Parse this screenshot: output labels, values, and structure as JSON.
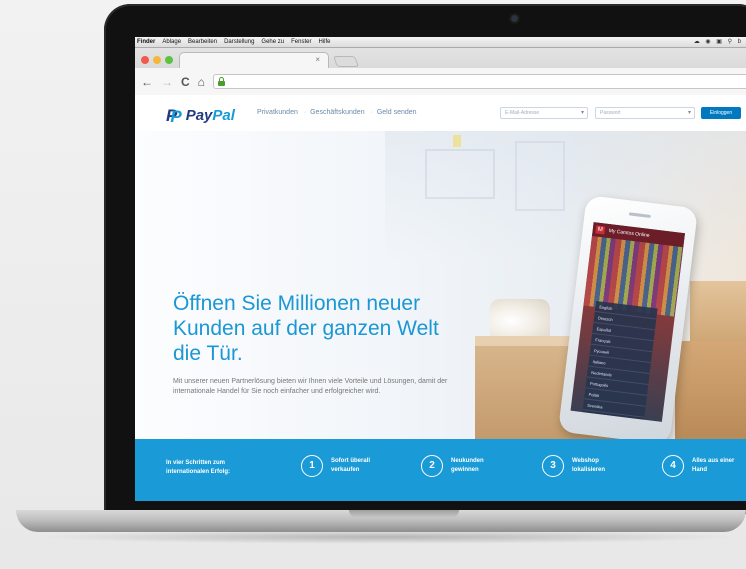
{
  "os_menubar": {
    "items": [
      "Finder",
      "Ablage",
      "Bearbeiten",
      "Darstellung",
      "Gehe zu",
      "Fenster",
      "Hilfe"
    ],
    "status": "☁ ◉ ▣ ⚲ b"
  },
  "browser": {
    "tab_close": "×",
    "nav": {
      "back": "←",
      "forward": "→",
      "reload": "C",
      "home": "⌂"
    }
  },
  "site": {
    "brand": {
      "logo_p": "P",
      "pay": "Pay",
      "pal": "Pal"
    },
    "nav": [
      "Privatkunden",
      "Geschäftskunden",
      "Geld senden"
    ],
    "nav_separator": "·",
    "email_placeholder": "E-Mail-Adresse",
    "password_placeholder": "Passwort",
    "login_label": "Einloggen",
    "headline": [
      "Öffnen Sie Millionen neuer",
      "Kunden auf der ganzen Welt",
      "die Tür."
    ],
    "subline": "Mit unserer neuen Partnerlösung bieten wir Ihnen viele Vorteile und Lösungen, damit der internationale Handel für Sie noch einfacher und erfolgreicher wird.",
    "phone": {
      "app_title": "My Camtos Online",
      "logo_letter": "M",
      "languages": [
        "English",
        "Deutsch",
        "Español",
        "Français",
        "Русский",
        "Italiano",
        "Nederlands",
        "Português",
        "Polski",
        "Svenska"
      ]
    },
    "steps": {
      "intro": [
        "In vier Schritten zum",
        "internationalen Erfolg:"
      ],
      "items": [
        {
          "num": "1",
          "line1": "Sofort überall",
          "line2": "verkaufen"
        },
        {
          "num": "2",
          "line1": "Neukunden",
          "line2": "gewinnen"
        },
        {
          "num": "3",
          "line1": "Webshop",
          "line2": "lokalisieren"
        },
        {
          "num": "4",
          "line1": "Alles aus einer",
          "line2": "Hand"
        }
      ]
    }
  },
  "colors": {
    "paypal_dark_blue": "#253b80",
    "paypal_light_blue": "#179bd7",
    "steps_band": "#1a9ad6",
    "login_button": "#0079c1"
  }
}
